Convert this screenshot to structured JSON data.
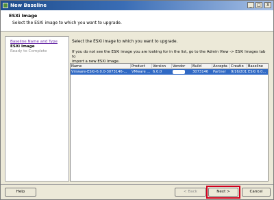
{
  "window": {
    "title": "New Baseline",
    "controls": [
      "_",
      "□",
      "X"
    ]
  },
  "header": {
    "title": "ESXi Image",
    "subtitle": "Select the ESXi image to which you want to upgrade."
  },
  "nav": {
    "items": [
      {
        "label": "Baseline Name and Type",
        "state": "visited"
      },
      {
        "label": "ESXi Image",
        "state": "current"
      },
      {
        "label": "Ready to Complete",
        "state": "upcoming"
      }
    ]
  },
  "content": {
    "instruction": "Select the ESXi image to which you want to upgrade.",
    "info_line1": "If you do not see the ESXi image you are looking for in the list, go to the Admin View -> ESXi Images tab to",
    "info_line2": "import a new ESXi Image."
  },
  "table": {
    "columns": [
      "Name",
      "Product",
      "Version",
      "Vendor",
      "Build",
      "Accepta",
      "Creatio",
      "Baseline"
    ],
    "rows": [
      [
        "Vmware-ESXi-6.0.0-3073146-...",
        "VMware ...",
        "6.0.0",
        "",
        "3073146",
        "Partner",
        "9/16/2015",
        "ESXi 6.0..."
      ]
    ],
    "selected_row": 0
  },
  "footer": {
    "help": "Help",
    "back": "< Back",
    "next": "Next >",
    "cancel": "Cancel"
  },
  "colors": {
    "selection": "#316ac5",
    "highlight_box": "#d0001c",
    "visited_link": "#6b2fa8"
  }
}
